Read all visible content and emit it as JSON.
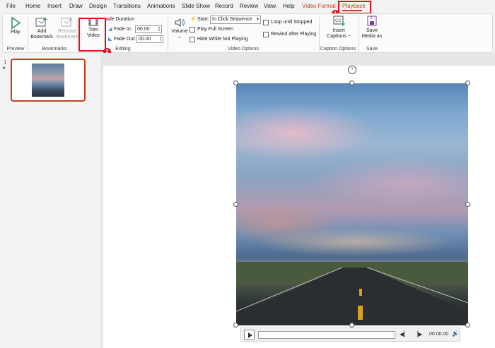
{
  "menu": {
    "file": "File",
    "home": "Home",
    "insert": "Insert",
    "draw": "Draw",
    "design": "Design",
    "transitions": "Transitions",
    "animations": "Animations",
    "slideshow": "Slide Show",
    "record": "Record",
    "review": "Review",
    "view": "View",
    "help": "Help",
    "video_format": "Video Format",
    "playback": "Playback"
  },
  "ribbon": {
    "preview": {
      "play": "Play",
      "group": "Preview"
    },
    "bookmarks": {
      "add_line1": "Add",
      "add_line2": "Bookmark",
      "remove_line1": "Remove",
      "remove_line2": "Bookmark",
      "group": "Bookmarks"
    },
    "editing": {
      "trim_line1": "Trim",
      "trim_line2": "Video",
      "fade_duration": "ade Duration",
      "fade_in_label": "Fade In:",
      "fade_in_value": "00.00",
      "fade_out_label": "Fade Out:",
      "fade_out_value": "00.00",
      "group": "Editing"
    },
    "video_options": {
      "volume": "Volume",
      "start_label": "Start:",
      "start_value": "In Click Sequence",
      "play_full_screen": "Play Full Screen",
      "hide_while_not_playing": "Hide While Not Playing",
      "loop_until_stopped": "Loop until Stopped",
      "rewind_after_playing": "Rewind after Playing",
      "group": "Video Options"
    },
    "caption_options": {
      "insert_line1": "Insert",
      "insert_line2": "Captions ~",
      "group": "Caption Options"
    },
    "save": {
      "save_line1": "Save",
      "save_line2": "Media as",
      "group": "Save"
    }
  },
  "callouts": {
    "one": "1",
    "two": "2"
  },
  "slides_pane": {
    "slide_number": "1",
    "star": "★"
  },
  "video_controls": {
    "time": "00:00.00"
  },
  "colors": {
    "accent": "#c43e1c",
    "highlight": "#e0101d"
  }
}
